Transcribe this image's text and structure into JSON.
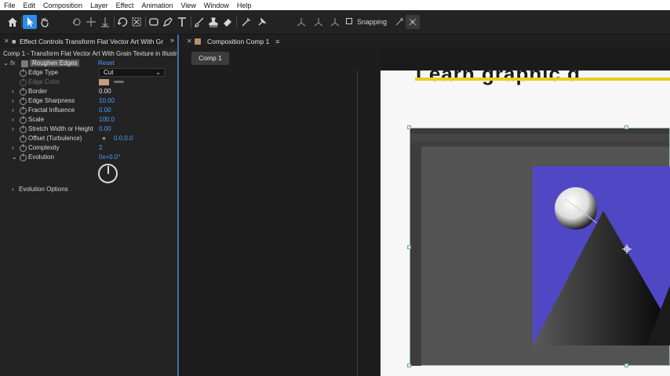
{
  "menu": [
    "File",
    "Edit",
    "Composition",
    "Layer",
    "Effect",
    "Animation",
    "View",
    "Window",
    "Help"
  ],
  "toolbar": {
    "snapping_label": "Snapping",
    "tools": [
      "home-icon",
      "selection-tool-icon",
      "hand-tool-icon",
      "rotation-tool-icon",
      "move-tool-icon",
      "move-down-icon",
      "orbit-icon",
      "region-icon",
      "rectangle-tool-icon",
      "pen-tool-icon",
      "type-tool-icon",
      "brush-tool-icon",
      "clone-stamp-icon",
      "eraser-icon",
      "roto-brush-icon",
      "puppet-pin-icon"
    ]
  },
  "effect_panel": {
    "tab_title": "Effect Controls Transform Flat Vector Art With Gr",
    "comp_line": "Comp 1 - Transform Flat Vector Art With Grain Texture in Illustrat",
    "effect_name": "Roughen Edges",
    "reset_label": "Reset",
    "fx_label": "fx",
    "properties": [
      {
        "name": "Edge Type",
        "value": "Cut"
      },
      {
        "name": "Edge Color",
        "value": ""
      },
      {
        "name": "Border",
        "value": "0.00"
      },
      {
        "name": "Edge Sharpness",
        "value": "10.00"
      },
      {
        "name": "Fractal Influence",
        "value": "0.00"
      },
      {
        "name": "Scale",
        "value": "100.0"
      },
      {
        "name": "Stretch Width or Height",
        "value": "0.00"
      },
      {
        "name": "Offset (Turbulence)",
        "value": "0.0,0.0"
      },
      {
        "name": "Complexity",
        "value": "2"
      },
      {
        "name": "Evolution",
        "value": "0x+0.0°"
      },
      {
        "name": "Evolution Options",
        "value": ""
      }
    ],
    "colors": {
      "edge_color": "#c99a82",
      "accent": "#4d9cff"
    }
  },
  "composition_panel": {
    "tab_title": "Composition Comp 1",
    "comp_tab": "Comp 1"
  },
  "viewer": {
    "headline": "Learn graphic d"
  }
}
